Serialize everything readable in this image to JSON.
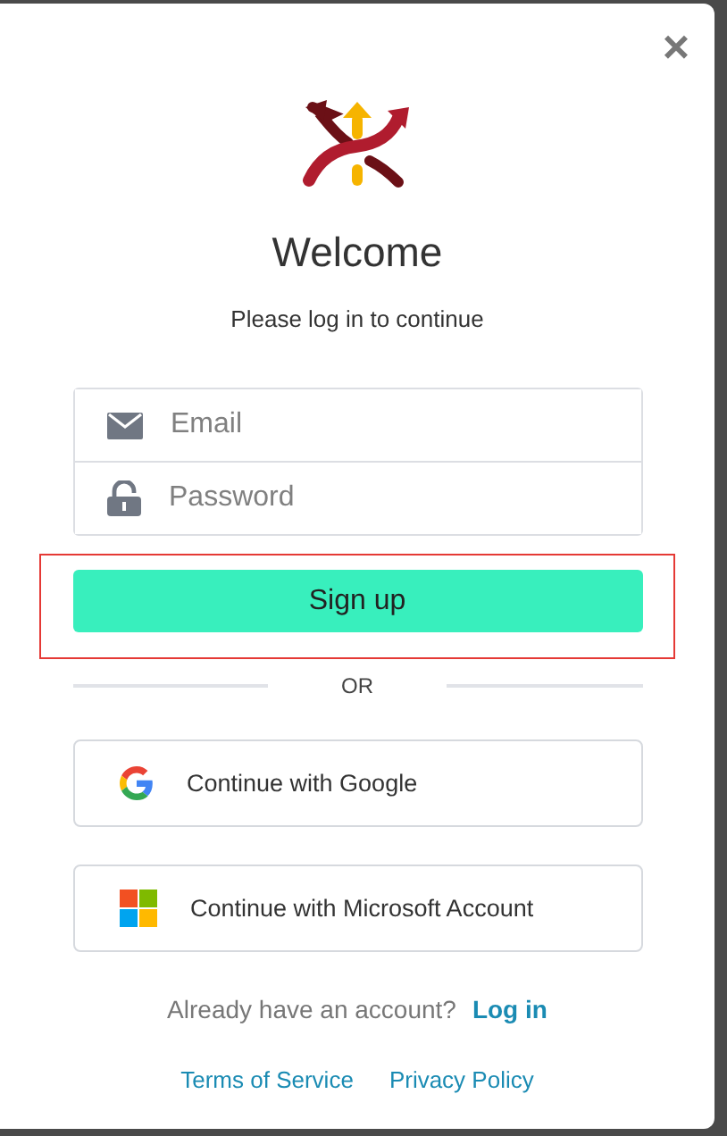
{
  "close": "×",
  "title": "Welcome",
  "subtitle": "Please log in to continue",
  "fields": [
    {
      "kind": "email",
      "placeholder": "Email"
    },
    {
      "kind": "password",
      "placeholder": "Password"
    }
  ],
  "primary_button": {
    "label": "Sign up",
    "highlighted": true
  },
  "divider": "OR",
  "providers": [
    {
      "kind": "google",
      "label": "Continue with Google"
    },
    {
      "kind": "microsoft",
      "label": "Continue with Microsoft Account"
    }
  ],
  "login_prompt": {
    "text": "Already have an account?",
    "link": "Log in"
  },
  "footer_links": [
    "Terms of Service",
    "Privacy Policy"
  ]
}
